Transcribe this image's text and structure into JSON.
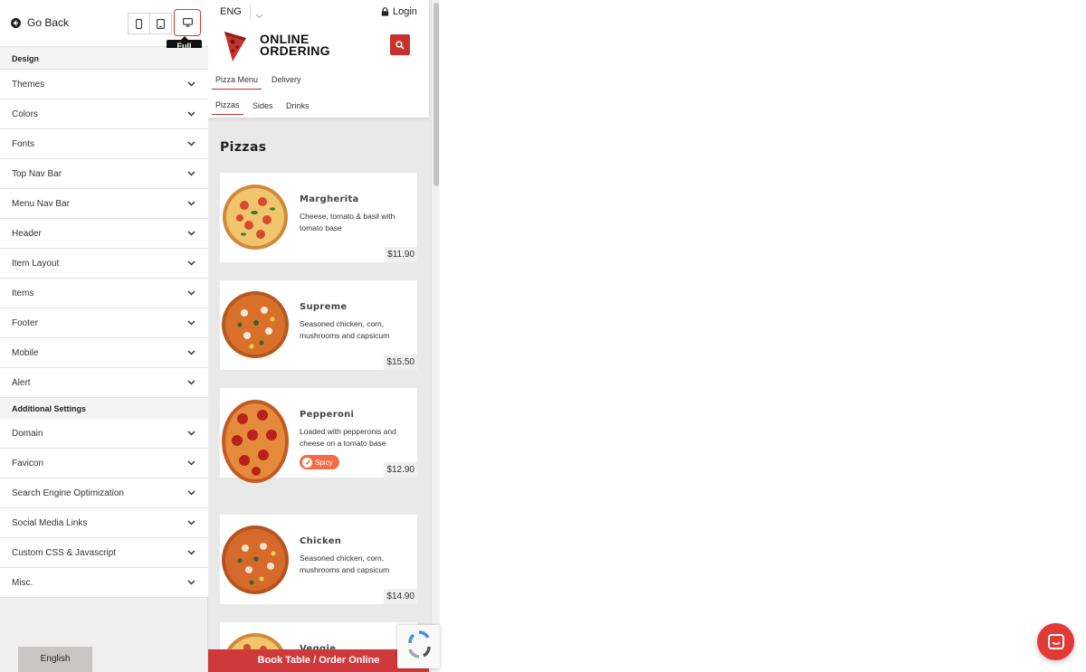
{
  "editor": {
    "go_back": "Go Back",
    "device_tooltip": "Full",
    "sections": [
      {
        "title": "Design",
        "items": [
          "Themes",
          "Colors",
          "Fonts",
          "Top Nav Bar",
          "Menu Nav Bar",
          "Header",
          "Item Layout",
          "Items",
          "Footer",
          "Mobile",
          "Alert"
        ]
      },
      {
        "title": "Additional Settings",
        "items": [
          "Domain",
          "Favicon",
          "Search Engine Optimization",
          "Social Media Links",
          "Custom CSS & Javascript",
          "Misc."
        ]
      }
    ],
    "language_button": "English"
  },
  "preview": {
    "language": "ENG",
    "login": "Login",
    "brand_line1": "ONLINE",
    "brand_line2": "ORDERING",
    "menu_tabs": [
      "Pizza Menu",
      "Delivery"
    ],
    "category_tabs": [
      "Pizzas",
      "Sides",
      "Drinks"
    ],
    "section_title": "Pizzas",
    "items": [
      {
        "name": "Margherita",
        "description": "Cheese, tomato & basil with tomato base",
        "price": "$11.90"
      },
      {
        "name": "Supreme",
        "description": "Seasoned chicken, corn, mushrooms and capsicum",
        "price": "$15.50"
      },
      {
        "name": "Pepperoni",
        "description": "Loaded with pepperonis and cheese on a tomato base",
        "price": "$12.90",
        "badge": "Spicy"
      },
      {
        "name": "Chicken",
        "description": "Seasoned chicken, corn, mushrooms and capsicum",
        "price": "$14.90"
      },
      {
        "name": "Veggie"
      }
    ],
    "order_bar": "Book Table / Order Online"
  },
  "colors": {
    "accent": "#c8302c",
    "spicy_badge": "#f46b45",
    "chat_button": "#e23a35"
  }
}
